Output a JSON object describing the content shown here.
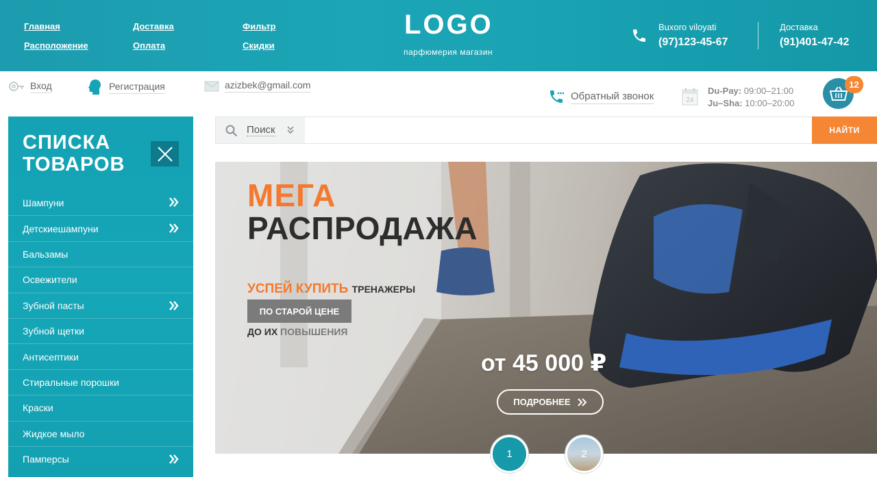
{
  "header": {
    "nav": [
      "Главная",
      "Расположение",
      "Доставка",
      "Оплата",
      "Фильтр",
      "Скидки"
    ],
    "logo": "LOGO",
    "logo_subtitle": "парфюмерия магазин",
    "contacts": [
      {
        "label": "Buxoro viloyati",
        "phone": "(97)123-45-67"
      },
      {
        "label": "Доставка",
        "phone": "(91)401-47-42"
      }
    ]
  },
  "topbar": {
    "login": "Вход",
    "register": "Регистрация",
    "email": "azizbek@gmail.com",
    "callback": "Обратный звонок",
    "hours": [
      {
        "days": "Du-Pay:",
        "time": "09:00–21:00"
      },
      {
        "days": "Ju–Sha:",
        "time": "10:00–20:00"
      }
    ],
    "calendar_day": "24",
    "cart_count": "12"
  },
  "sidebar": {
    "title_line1": "СПИСКА",
    "title_line2": "ТОВАРОВ",
    "items": [
      {
        "label": "Шампуни",
        "has_submenu": true
      },
      {
        "label": "Детскиешампуни",
        "has_submenu": true
      },
      {
        "label": "Бальзамы",
        "has_submenu": false
      },
      {
        "label": "Освежители",
        "has_submenu": false
      },
      {
        "label": "Зубной пасты",
        "has_submenu": true
      },
      {
        "label": "Зубной щетки",
        "has_submenu": false
      },
      {
        "label": "Антисептики",
        "has_submenu": false
      },
      {
        "label": "Стиральные порошки",
        "has_submenu": false
      },
      {
        "label": "Краски",
        "has_submenu": false
      },
      {
        "label": "Жидкое мыло",
        "has_submenu": false
      },
      {
        "label": "Памперсы",
        "has_submenu": true
      }
    ]
  },
  "search": {
    "category_label": "Поиск",
    "button": "НАЙТИ"
  },
  "banner": {
    "line1": "МЕГА",
    "line2": "РАСПРОДАЖА",
    "hurry": "УСПЕЙ КУПИТЬ",
    "hurry_small": "ТРЕНАЖЕРЫ",
    "old_price_label": "ПО СТАРОЙ ЦЕНЕ",
    "until": "ДО ИХ",
    "until_accent": "ПОВЫШЕНИЯ",
    "price": "от 45 000 ₽",
    "more_button": "ПОДРОБНЕЕ"
  },
  "pager": [
    "1",
    "2"
  ],
  "colors": {
    "teal": "#16a3b5",
    "orange": "#f58634",
    "dark_teal": "#0e7b8c"
  }
}
